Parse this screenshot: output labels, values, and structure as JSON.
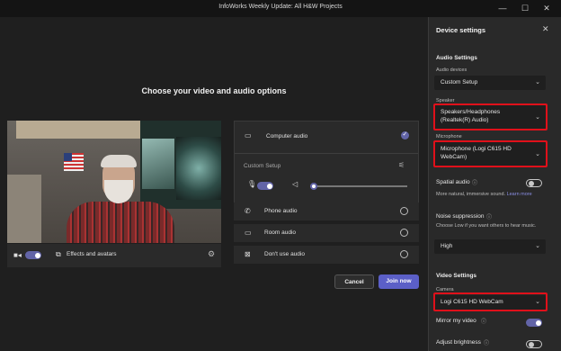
{
  "window": {
    "title": "InfoWorks Weekly Update: All H&W Projects",
    "controls": {
      "minimize": "—",
      "maximize": "☐",
      "close": "✕"
    }
  },
  "main": {
    "heading": "Choose your video and audio options",
    "video_controls": {
      "camera_icon": "camera-icon",
      "camera_on": true,
      "effects_label": "Effects and avatars"
    },
    "audio": {
      "options": [
        {
          "label": "Computer audio",
          "icon": "monitor-icon",
          "selected": true
        },
        {
          "label": "Phone audio",
          "icon": "phone-icon",
          "selected": false
        },
        {
          "label": "Room audio",
          "icon": "room-icon",
          "selected": false
        },
        {
          "label": "Don't use audio",
          "icon": "no-audio-icon",
          "selected": false
        }
      ],
      "custom_setup_label": "Custom Setup",
      "mic_on": true,
      "speaker_volume": 0.02
    },
    "buttons": {
      "cancel": "Cancel",
      "join": "Join now"
    }
  },
  "panel": {
    "title": "Device settings",
    "audio_settings": {
      "heading": "Audio Settings",
      "devices_label": "Audio devices",
      "devices_value": "Custom Setup",
      "speaker_label": "Speaker",
      "speaker_value": "Speakers/Headphones (Realtek(R) Audio)",
      "microphone_label": "Microphone",
      "microphone_value": "Microphone (Logi C615 HD WebCam)",
      "spatial_label": "Spatial audio",
      "spatial_on": false,
      "spatial_desc": "More natural, immersive sound.",
      "learn_more": "Learn more",
      "noise_label": "Noise suppression",
      "noise_desc": "Choose Low if you want others to hear music.",
      "noise_value": "High"
    },
    "video_settings": {
      "heading": "Video Settings",
      "camera_label": "Camera",
      "camera_value": "Logi C615 HD WebCam",
      "mirror_label": "Mirror my video",
      "mirror_on": true,
      "brightness_label": "Adjust brightness",
      "brightness_on": false
    }
  },
  "colors": {
    "accent": "#5b5fc7",
    "highlight": "#e0101a",
    "panel_bg": "#292929"
  }
}
